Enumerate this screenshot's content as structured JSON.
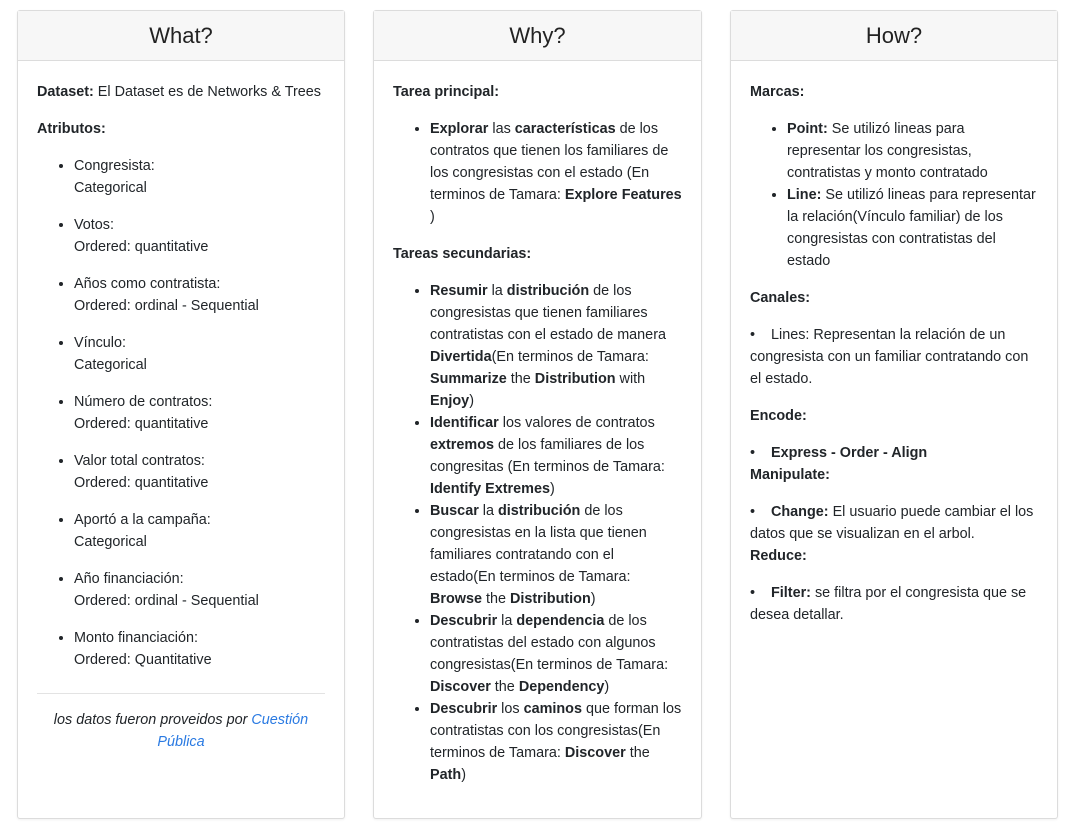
{
  "what": {
    "header": "What?",
    "dataset_label": "Dataset:",
    "dataset_text": " El Dataset es de Networks & Trees",
    "attributes_label": "Atributos:",
    "attributes": [
      {
        "name": "Congresista:",
        "type": "Categorical"
      },
      {
        "name": "Votos:",
        "type": "Ordered: quantitative"
      },
      {
        "name": "Años como contratista:",
        "type": "Ordered: ordinal - Sequential"
      },
      {
        "name": "Vínculo:",
        "type": "Categorical"
      },
      {
        "name": "Número de contratos:",
        "type": "Ordered: quantitative"
      },
      {
        "name": "Valor total contratos:",
        "type": "Ordered: quantitative"
      },
      {
        "name": "Aportó a la campaña:",
        "type": "Categorical"
      },
      {
        "name": "Año financiación:",
        "type": "Ordered: ordinal - Sequential"
      },
      {
        "name": "Monto financiación:",
        "type": "Ordered: Quantitative"
      }
    ],
    "footnote_text": "los datos fueron proveidos por ",
    "footnote_link": "Cuestión Pública"
  },
  "why": {
    "header": "Why?",
    "main_label": "Tarea principal:",
    "main": {
      "b1": "Explorar",
      "t1": " las ",
      "b2": "características",
      "t2": " de los contratos que tienen los familiares de los congresistas con el estado (En terminos de Tamara: ",
      "b3": "Explore Features",
      "t3": " )"
    },
    "secondary_label": "Tareas secundarias:",
    "secondary": [
      {
        "b1": "Resumir",
        "t1": " la ",
        "b2": "distribución",
        "t2": " de los congresistas que tienen familiares contratistas con el estado de manera ",
        "b3": "Divertida",
        "t3": "(En terminos de Tamara: ",
        "b4": "Summarize",
        "t4": " the ",
        "b5": "Distribution",
        "t5": " with ",
        "b6": "Enjoy",
        "t6": ")"
      },
      {
        "b1": "Identificar",
        "t1": " los valores de contratos ",
        "b2": "extremos",
        "t2": " de los familiares de los congresitas (En terminos de Tamara: ",
        "b3": "Identify Extremes",
        "t3": ")"
      },
      {
        "b1": "Buscar",
        "t1": " la ",
        "b2": "distribución",
        "t2": " de los congresistas en la lista que tienen familiares contratando con el estado(En terminos de Tamara: ",
        "b3": "Browse",
        "t3": " the ",
        "b4": "Distribution",
        "t4": ")"
      },
      {
        "b1": "Descubrir",
        "t1": " la ",
        "b2": "dependencia",
        "t2": " de los contratistas del estado con algunos congresistas(En terminos de Tamara: ",
        "b3": "Discover",
        "t3": " the ",
        "b4": "Dependency",
        "t4": ")"
      },
      {
        "b1": "Descubrir",
        "t1": " los ",
        "b2": "caminos",
        "t2": " que forman los contratistas con los congresistas(En terminos de Tamara: ",
        "b3": "Discover",
        "t3": " the ",
        "b4": "Path",
        "t4": ")"
      }
    ]
  },
  "how": {
    "header": "How?",
    "marks_label": "Marcas:",
    "marks": [
      {
        "label": "Point:",
        "text": " Se utilizó lineas para representar los congresistas, contratistas y monto contratado"
      },
      {
        "label": "Line:",
        "text": " Se utilizó lineas para representar la relación(Vínculo familiar) de los congresistas con contratistas del estado"
      }
    ],
    "channels_label": "Canales:",
    "channels_text": "Lines: Representan la relación de un congresista con un familiar contratando con el estado.",
    "encode_label": "Encode:",
    "encode_text": "Express - Order - Align",
    "manipulate_label": "Manipulate:",
    "change_label": "Change:",
    "change_text": " El usuario puede cambiar el los datos que se visualizan en el arbol.",
    "reduce_label": "Reduce:",
    "filter_label": "Filter:",
    "filter_text": " se filtra por el congresista que se desea detallar."
  }
}
